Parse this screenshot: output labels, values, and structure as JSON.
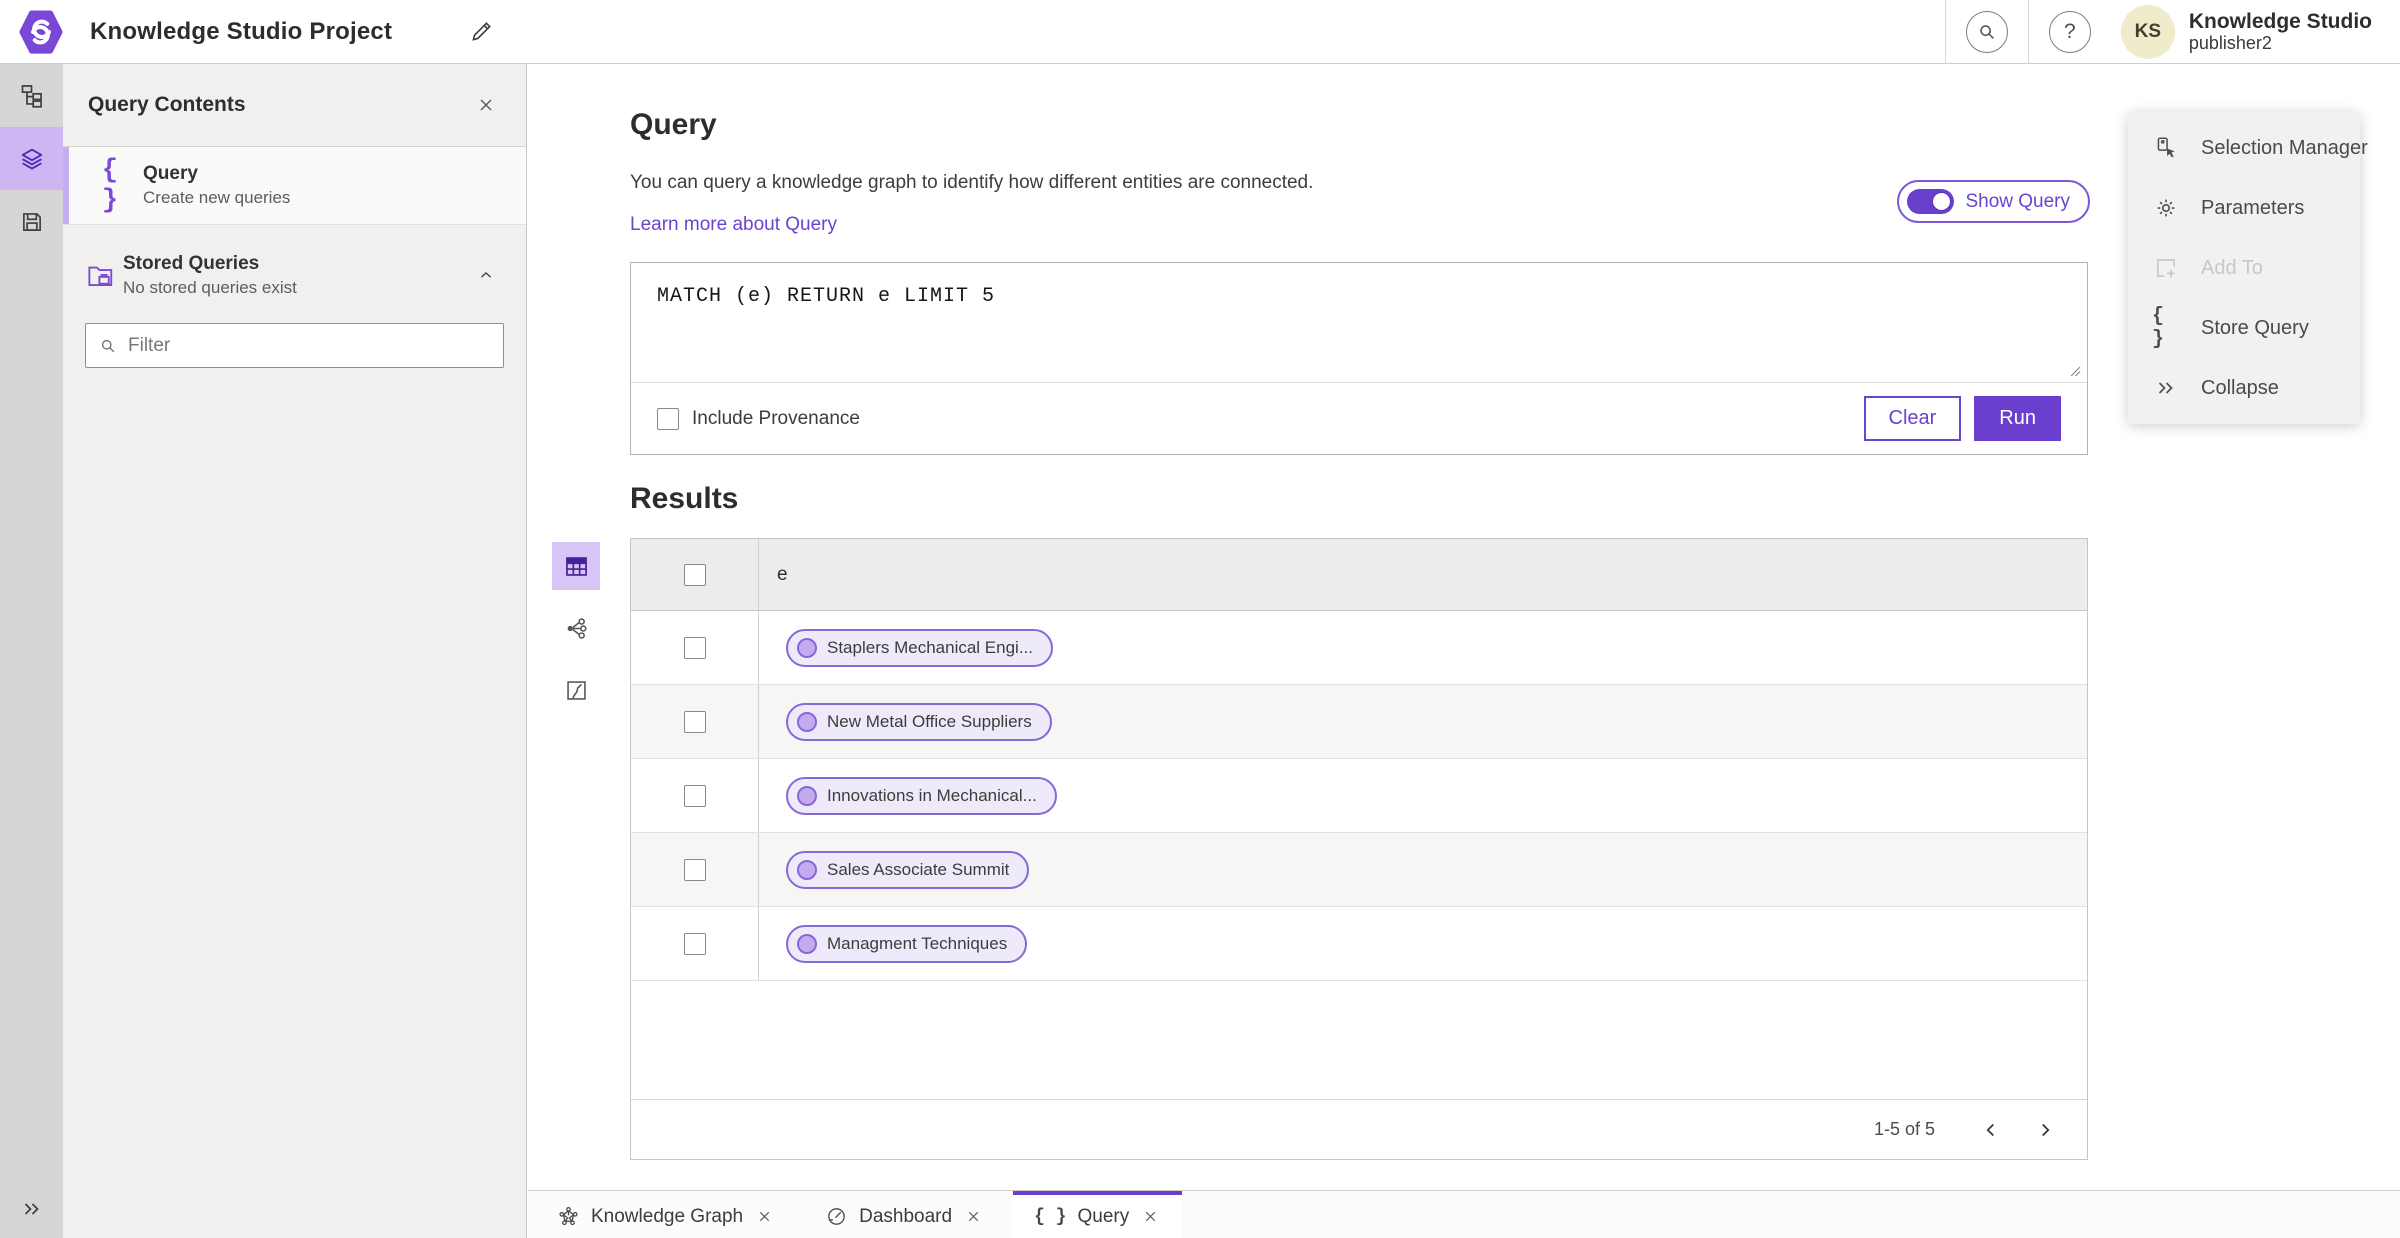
{
  "colors": {
    "brand_purple": "#6a3fce",
    "link_purple": "#6a43cf",
    "selected_rail_purple": "#cdb6f2",
    "pill_background": "#efeaf9",
    "pill_border": "#8768d9",
    "avatar_background": "#eeeccb",
    "panel_gray": "#f1f0ee",
    "rail_gray": "#d7d6d4"
  },
  "icons": {
    "logo": "purple-hexagon-swirl",
    "left_rail": [
      "data-model-icon",
      "layers-icon",
      "save-icon",
      "expand-double-chevron-icon"
    ],
    "view_switcher": [
      "table-view-icon",
      "link-chart-view-icon",
      "map-view-icon"
    ]
  },
  "header": {
    "title": "Knowledge Studio Project",
    "help_glyph": "?",
    "avatar_initials": "KS",
    "user_name": "Knowledge Studio",
    "user_role": "publisher2"
  },
  "contents_panel": {
    "title": "Query Contents",
    "query_item": {
      "icon_glyph": "{ }",
      "title": "Query",
      "subtitle": "Create new queries"
    },
    "stored_queries": {
      "title": "Stored Queries",
      "subtitle": "No stored queries exist"
    },
    "filter": {
      "placeholder": "Filter"
    }
  },
  "query_section": {
    "title": "Query",
    "description": "You can query a knowledge graph to identify how different entities are connected.",
    "learn_more_label": "Learn more about Query",
    "show_query_label": "Show Query",
    "show_query_on": true,
    "query_text": "MATCH (e) RETURN e LIMIT 5",
    "include_provenance_label": "Include Provenance",
    "include_provenance_checked": false,
    "clear_label": "Clear",
    "run_label": "Run"
  },
  "results_section": {
    "title": "Results",
    "column_header": "e",
    "rows": [
      {
        "label": "Staplers Mechanical Engi..."
      },
      {
        "label": "New Metal Office Suppliers"
      },
      {
        "label": "Innovations in Mechanical..."
      },
      {
        "label": "Sales Associate Summit"
      },
      {
        "label": "Managment Techniques"
      }
    ],
    "pagination": {
      "range_label": "1-5 of 5"
    }
  },
  "side_menu": {
    "items": [
      {
        "label": "Selection Manager",
        "disabled": false
      },
      {
        "label": "Parameters",
        "disabled": false
      },
      {
        "label": "Add To",
        "disabled": true
      },
      {
        "label": "Store Query",
        "disabled": false,
        "icon_glyph": "{ }"
      },
      {
        "label": "Collapse",
        "disabled": false
      }
    ]
  },
  "tab_bar": {
    "tabs": [
      {
        "label": "Knowledge Graph",
        "active": false
      },
      {
        "label": "Dashboard",
        "active": false
      },
      {
        "label": "Query",
        "active": true,
        "icon_glyph": "{ }"
      }
    ]
  }
}
